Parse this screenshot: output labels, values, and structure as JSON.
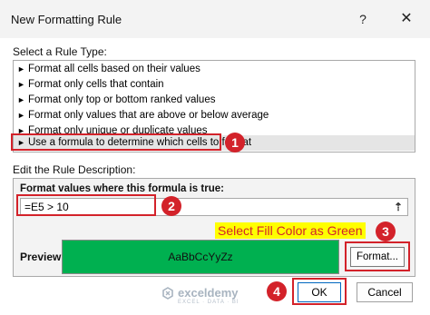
{
  "dialog": {
    "title": "New Formatting Rule",
    "help_glyph": "?",
    "close_glyph": "✕"
  },
  "rule_type": {
    "label": "Select a Rule Type:",
    "items": [
      {
        "label": "Format all cells based on their values",
        "selected": false
      },
      {
        "label": "Format only cells that contain",
        "selected": false
      },
      {
        "label": "Format only top or bottom ranked values",
        "selected": false
      },
      {
        "label": "Format only values that are above or below average",
        "selected": false
      },
      {
        "label": "Format only unique or duplicate values",
        "selected": false
      },
      {
        "label": "Use a formula to determine which cells to format",
        "selected": true
      }
    ],
    "bullet_glyph": "►"
  },
  "description": {
    "label": "Edit the Rule Description:",
    "formula_label": "Format values where this formula is true:",
    "formula_value": "=E5 > 10",
    "collapse_glyph": "⇡",
    "preview_label": "Preview:",
    "preview_sample": "AaBbCcYyZz",
    "preview_color": "#00b050",
    "format_button": "Format..."
  },
  "footer": {
    "ok_label": "OK",
    "cancel_label": "Cancel"
  },
  "annotations": {
    "step_badges": [
      "1",
      "2",
      "3",
      "4"
    ],
    "fill_note": "Select Fill Color as Green",
    "accent_color": "#d3222a",
    "highlight_color": "#ffff00"
  },
  "watermark": {
    "name": "exceldemy",
    "tagline": "EXCEL · DATA · BI",
    "icon": "exceldemy-logo-icon"
  }
}
